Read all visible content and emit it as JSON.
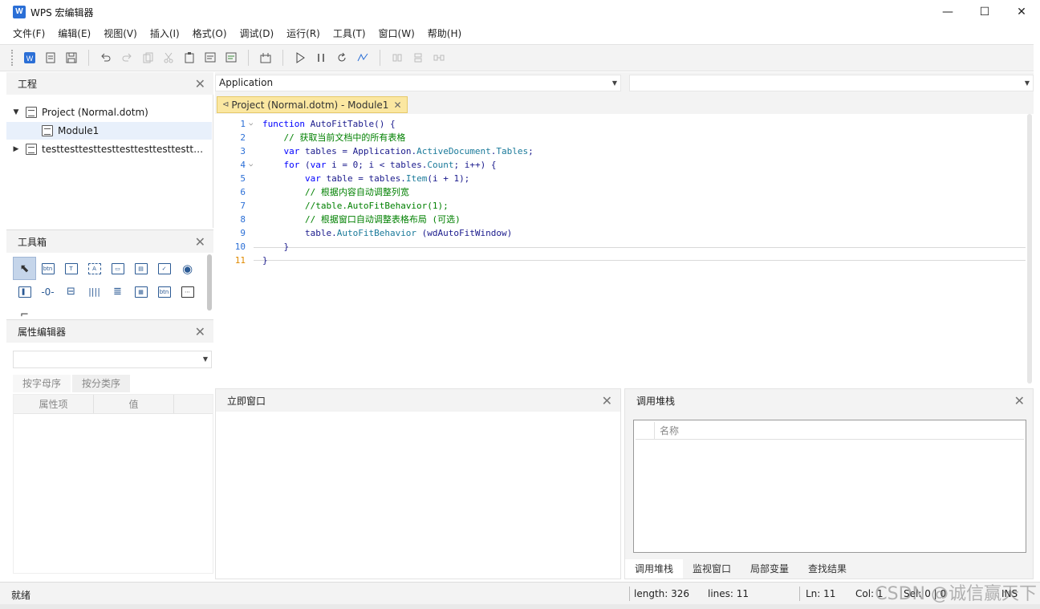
{
  "window": {
    "title": "WPS 宏编辑器",
    "logo_text": "W",
    "controls": [
      "—",
      "☐",
      "✕"
    ]
  },
  "menu": [
    "文件(F)",
    "编辑(E)",
    "视图(V)",
    "插入(I)",
    "格式(O)",
    "调试(D)",
    "运行(R)",
    "工具(T)",
    "窗口(W)",
    "帮助(H)"
  ],
  "toolbar": {
    "icons": [
      "wps-icon",
      "new-module-icon",
      "save-icon",
      "undo-icon",
      "redo-icon",
      "copy-icon",
      "cut-icon",
      "paste-icon",
      "comment-icon",
      "uncomment-icon",
      "design-mode-icon",
      "run-icon",
      "pause-icon",
      "reset-icon",
      "debug-icon",
      "align-left-icon",
      "align-center-icon",
      "align-distribute-icon"
    ]
  },
  "project_panel": {
    "title": "工程",
    "tree": [
      {
        "label": "Project (Normal.dotm)",
        "expanded": true
      },
      {
        "label": "Module1",
        "selected": true
      },
      {
        "label": "testtesttesttesttesttesttesttesttest...",
        "expanded": false
      }
    ]
  },
  "toolbox_panel": {
    "title": "工具箱",
    "tools": [
      "pointer",
      "btn",
      "T",
      "A",
      "frame",
      "combo",
      "check",
      "radio",
      "listbox",
      "spin",
      "scroll",
      "hscroll",
      "vscroll",
      "multipage",
      "btn2",
      "image",
      "folder"
    ]
  },
  "property_panel": {
    "title": "属性编辑器",
    "tabs": [
      "按字母序",
      "按分类序"
    ],
    "columns": [
      "属性项",
      "值"
    ]
  },
  "editor": {
    "object_combo": "Application",
    "proc_combo": "",
    "tab_label": "Project (Normal.dotm) - Module1",
    "current_line": 11,
    "lines": [
      {
        "n": 1,
        "text": "function AutoFitTable() {"
      },
      {
        "n": 2,
        "text": "    // 获取当前文档中的所有表格"
      },
      {
        "n": 3,
        "text": "    var tables = Application.ActiveDocument.Tables;"
      },
      {
        "n": 4,
        "text": "    for (var i = 0; i < tables.Count; i++) {"
      },
      {
        "n": 5,
        "text": "        var table = tables.Item(i + 1);"
      },
      {
        "n": 6,
        "text": "        // 根据内容自动调整列宽"
      },
      {
        "n": 7,
        "text": "        //table.AutoFitBehavior(1);"
      },
      {
        "n": 8,
        "text": "        // 根据窗口自动调整表格布局 (可选)"
      },
      {
        "n": 9,
        "text": "        table.AutoFitBehavior (wdAutoFitWindow)"
      },
      {
        "n": 10,
        "text": "    }"
      },
      {
        "n": 11,
        "text": "}"
      }
    ]
  },
  "immediate_panel": {
    "title": "立即窗口"
  },
  "callstack_panel": {
    "title": "调用堆栈",
    "column": "名称",
    "tabs": [
      "调用堆栈",
      "监视窗口",
      "局部变量",
      "查找结果"
    ]
  },
  "status": {
    "left": "就绪",
    "length": "length: 326",
    "lines": "lines: 11",
    "ln": "Ln: 11",
    "col": "Col: 1",
    "sel": "Sel: 0 | 0",
    "mode": "INS"
  },
  "watermark": "CSDN @诚信赢天下"
}
